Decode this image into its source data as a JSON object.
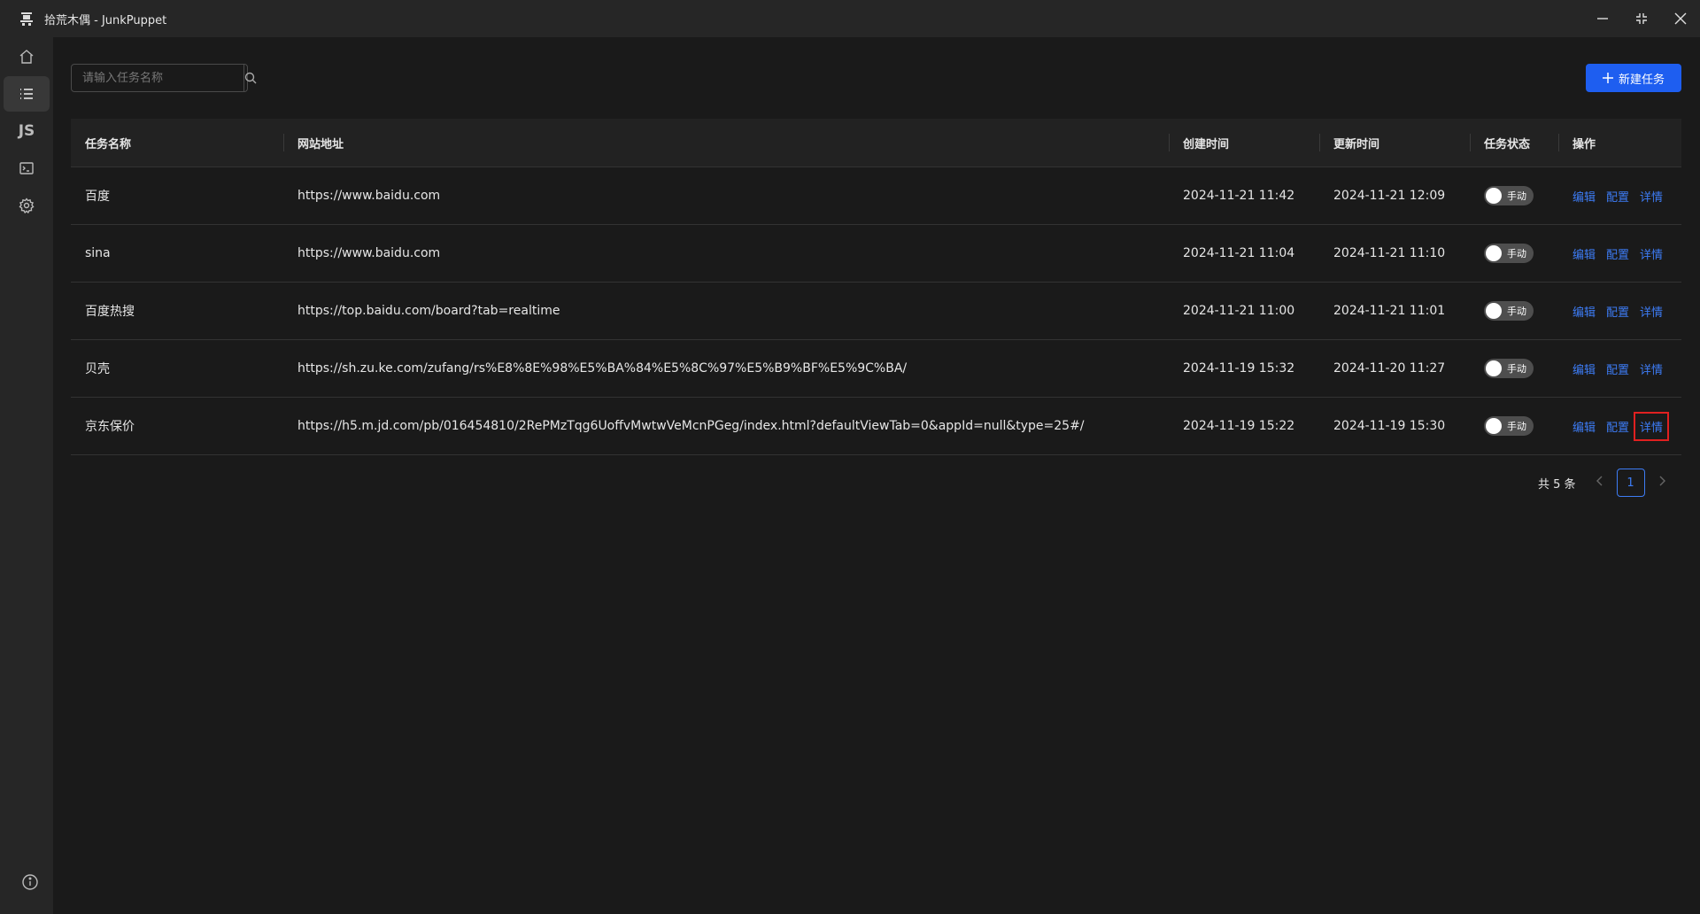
{
  "window": {
    "title": "拾荒木偶 - JunkPuppet",
    "icon": "app-logo-icon"
  },
  "sidebar": {
    "items": [
      {
        "id": "home",
        "icon": "home-icon"
      },
      {
        "id": "tasks",
        "icon": "list-icon",
        "active": true
      },
      {
        "id": "js",
        "label": "JS"
      },
      {
        "id": "terminal",
        "icon": "terminal-icon"
      },
      {
        "id": "settings",
        "icon": "gear-icon"
      }
    ],
    "bottom": {
      "icon": "info-icon"
    }
  },
  "toolbar": {
    "search_placeholder": "请输入任务名称",
    "new_button_label": "新建任务"
  },
  "table": {
    "headers": [
      "任务名称",
      "网站地址",
      "创建时间",
      "更新时间",
      "任务状态",
      "操作"
    ],
    "rows": [
      {
        "name": "百度",
        "url": "https://www.baidu.com",
        "created": "2024-11-21 11:42",
        "updated": "2024-11-21 12:09",
        "status": "手动"
      },
      {
        "name": "sina",
        "url": "https://www.baidu.com",
        "created": "2024-11-21 11:04",
        "updated": "2024-11-21 11:10",
        "status": "手动"
      },
      {
        "name": "百度热搜",
        "url": "https://top.baidu.com/board?tab=realtime",
        "created": "2024-11-21 11:00",
        "updated": "2024-11-21 11:01",
        "status": "手动"
      },
      {
        "name": "贝壳",
        "url": "https://sh.zu.ke.com/zufang/rs%E8%8E%98%E5%BA%84%E5%8C%97%E5%B9%BF%E5%9C%BA/",
        "created": "2024-11-19 15:32",
        "updated": "2024-11-20 11:27",
        "status": "手动"
      },
      {
        "name": "京东保价",
        "url": "https://h5.m.jd.com/pb/016454810/2RePMzTqg6UoffvMwtwVeMcnPGeg/index.html?defaultViewTab=0&appId=null&type=25#/",
        "created": "2024-11-19 15:22",
        "updated": "2024-11-19 15:30",
        "status": "手动"
      }
    ],
    "actions": {
      "edit": "编辑",
      "config": "配置",
      "detail": "详情"
    }
  },
  "pagination": {
    "total": "共 5 条",
    "current": "1"
  },
  "colors": {
    "accent": "#1e5ef0",
    "link": "#3d7cf5",
    "highlight": "#e02020"
  }
}
